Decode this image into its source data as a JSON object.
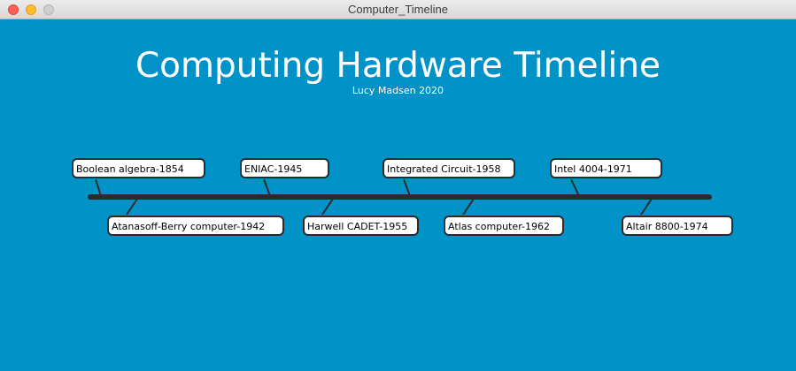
{
  "window": {
    "title": "Computer_Timeline",
    "background": "#0193c8"
  },
  "header": {
    "title": "Computing Hardware Timeline",
    "subtitle": "Lucy Madsen 2020"
  },
  "timeline": {
    "line_color": "#2b2b2b",
    "events_above": [
      {
        "label": "Boolean algebra-1854"
      },
      {
        "label": "ENIAC-1945"
      },
      {
        "label": "Integrated Circuit-1958"
      },
      {
        "label": "Intel 4004-1971"
      }
    ],
    "events_below": [
      {
        "label": "Atanasoff-Berry computer-1942"
      },
      {
        "label": "Harwell CADET-1955"
      },
      {
        "label": "Atlas computer-1962"
      },
      {
        "label": "Altair 8800-1974"
      }
    ]
  }
}
